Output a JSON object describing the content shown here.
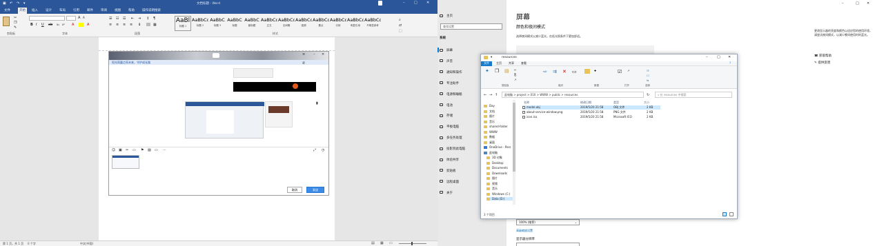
{
  "word": {
    "title": "文档标题 - Word",
    "tabs": [
      "文件",
      "开始",
      "插入",
      "设计",
      "布局",
      "引用",
      "邮件",
      "审阅",
      "视图",
      "帮助",
      "操作说明搜索"
    ],
    "active_tab": "开始",
    "groups": [
      "剪贴板",
      "字体",
      "段落",
      "样式"
    ],
    "styles": [
      {
        "sample": "AaBl",
        "name": "标题 1"
      },
      {
        "sample": "AaBbCcI",
        "name": "标题 2"
      },
      {
        "sample": "AaBbC",
        "name": "标题 3"
      },
      {
        "sample": "AaBbC",
        "name": "标题"
      },
      {
        "sample": "AaBbC",
        "name": "副标题"
      },
      {
        "sample": "AaBbCcD",
        "name": "正文"
      },
      {
        "sample": "AaBbCcD",
        "name": "无间隔"
      },
      {
        "sample": "AaBbCcD",
        "name": "强调"
      },
      {
        "sample": "AaBbCcD",
        "name": "要点"
      },
      {
        "sample": "AaBbCcD",
        "name": "引用"
      },
      {
        "sample": "AaBbCcD",
        "name": "明显引用"
      },
      {
        "sample": "AaBbCcD",
        "name": "不明显参考"
      }
    ],
    "embedded_link": "阳光雨露点亮未来，守护成长路",
    "embedded_buttons": {
      "cancel": "取消",
      "ok": "发送"
    },
    "status": {
      "page": "第 1 页，共 1 页",
      "words": "0 个字",
      "lang": "中文(中国)"
    }
  },
  "settings": {
    "nav_top": [
      "主页",
      "查找设置"
    ],
    "nav_section": "系统",
    "nav": [
      "屏幕",
      "声音",
      "通知和操作",
      "专注助手",
      "电源和睡眠",
      "电池",
      "存储",
      "平板电脑",
      "多任务处理",
      "投影到此电脑",
      "体验共享",
      "剪贴板",
      "远程桌面",
      "关于"
    ],
    "title": "屏幕",
    "subtitle": "颜色和夜间模式",
    "desc": "选择夜间模式以减少蓝光，在低光照条件下更加舒适。",
    "zoom_value": "100% (推荐)",
    "advanced_link": "高级缩放设置",
    "resolution_label": "显示器分辨率",
    "right_text": "更改显示器的亮度和颜色以适应您的使用环境，请尝试夜间模式，以减少晚间使用时的蓝光。",
    "links": [
      "获取帮助",
      "提供反馈"
    ]
  },
  "explorer": {
    "title": "resources",
    "tabs": [
      "文件",
      "主页",
      "共享",
      "查看"
    ],
    "ribbon_groups": [
      "剪贴板",
      "组织",
      "新建",
      "打开",
      "选择"
    ],
    "address": "此电脑 > project > 010 > WWW > public > resources",
    "search_placeholder": "在 resources 中搜索",
    "columns": [
      "名称",
      "修改日期",
      "类型",
      "大小"
    ],
    "files": [
      {
        "name": "model.obj",
        "date": "2019/5/20 21:58",
        "type": "OBJ 文件",
        "size": "2 KB"
      },
      {
        "name": "about-service-window.png",
        "date": "2019/5/20 21:58",
        "type": "PNG 文件",
        "size": "2 KB"
      },
      {
        "name": "icon.ico",
        "date": "2019/5/20 21:58",
        "type": "Microsoft ICO",
        "size": "2 KB"
      }
    ],
    "tree": [
      "Day",
      "文档",
      "图片",
      "音乐",
      "shared-folder",
      "WWW",
      "数据",
      "桌面",
      "OneDrive - Pers",
      "此电脑",
      "3D 对象",
      "Desktop",
      "Documents",
      "Downloads",
      "图片",
      "视频",
      "音乐",
      "Windows (C:)",
      "Data (D:)"
    ],
    "status": "3 个项目"
  },
  "colors": {
    "word_blue": "#2b579a",
    "selection": "#cce8ff",
    "explorer_file_tab": "#1979ca"
  }
}
